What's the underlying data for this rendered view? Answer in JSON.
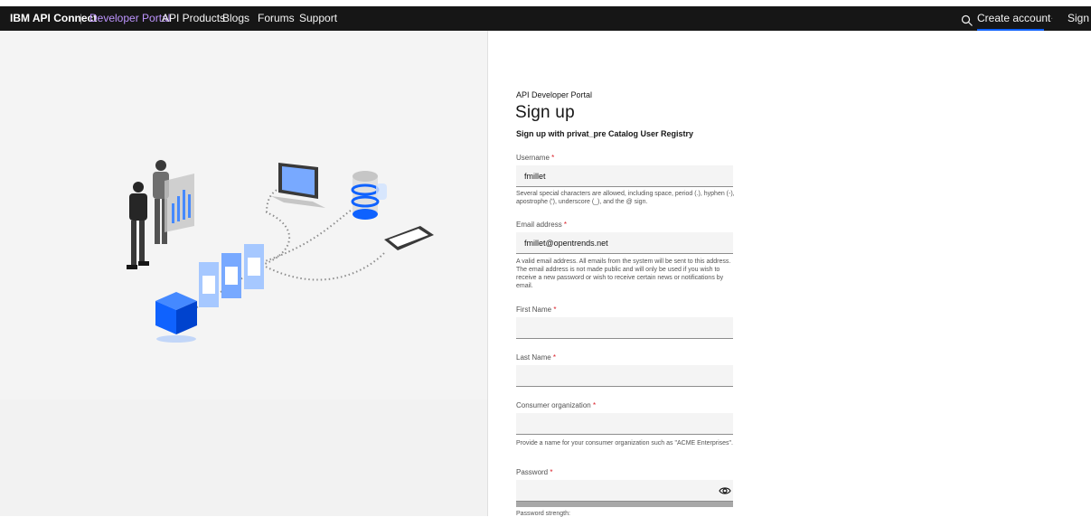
{
  "header": {
    "brand": "IBM API Connect",
    "separator": "|",
    "portal": "Developer Portal",
    "nav": [
      "API Products",
      "Blogs",
      "Forums",
      "Support"
    ],
    "create_account": "Create account",
    "dot": "·",
    "sign_in": "Sign in",
    "search_icon": "search-icon"
  },
  "form": {
    "kicker": "API Developer Portal",
    "title": "Sign up",
    "subtitle": "Sign up with privat_pre Catalog User Registry",
    "required_mark": "*",
    "username": {
      "label": "Username",
      "value": "fmillet",
      "help": "Several special characters are allowed, including space, period (.), hyphen (-), apostrophe ('), underscore (_), and the @ sign."
    },
    "email": {
      "label": "Email address",
      "value": "fmillet@opentrends.net",
      "help": "A valid email address. All emails from the system will be sent to this address. The email address is not made public and will only be used if you wish to receive a new password or wish to receive certain news or notifications by email."
    },
    "first_name": {
      "label": "First Name",
      "value": ""
    },
    "last_name": {
      "label": "Last Name",
      "value": ""
    },
    "consumer_org": {
      "label": "Consumer organization",
      "value": "",
      "help": "Provide a name for your consumer organization such as \"ACME Enterprises\"."
    },
    "password": {
      "label": "Password",
      "value": "",
      "show_icon": "eye-icon"
    },
    "password_strength_label": "Password strength:"
  },
  "colors": {
    "nav_bg": "#161616",
    "portal_accent": "#be95ff",
    "active_underline": "#0f62fe",
    "required": "#da1e28",
    "cube": "#0f62fe"
  }
}
